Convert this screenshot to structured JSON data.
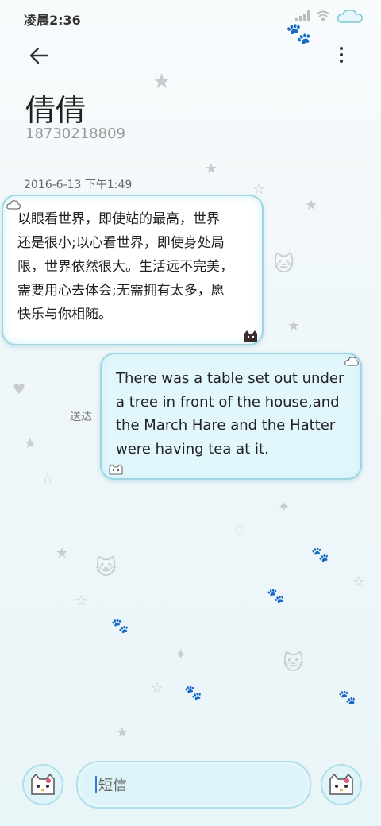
{
  "status_bar": {
    "time": "凌晨2:36"
  },
  "header": {
    "back_icon": "arrow-left-icon",
    "more_icon": "more-vertical-icon",
    "contact_name": "倩倩",
    "contact_number": "18730218809"
  },
  "conversation": {
    "timestamp": "2016-6-13 下午1:49",
    "incoming": {
      "lines": [
        "以眼看世界，即使站的最高，世界",
        "还是很小;以心看世界，即使身处局",
        "限，世界依然很大。生活远不完美，",
        "需要用心去体会;无需拥有太多，愿",
        "快乐与你相随。"
      ]
    },
    "outgoing": {
      "lines": [
        "There was a table set out under",
        "a tree in front of the house,and",
        "the March Hare and the Hatter",
        "were having tea at it."
      ],
      "status": "送达"
    }
  },
  "composer": {
    "placeholder": "短信",
    "left_button_icon": "emoji-sticker-icon",
    "right_button_icon": "emoji-sticker-icon"
  },
  "colors": {
    "bubble_border": "#9ed6e4",
    "outgoing_bubble": "#e2f7fb",
    "incoming_bubble": "#ffffff",
    "cursor": "#3a7bd5"
  }
}
